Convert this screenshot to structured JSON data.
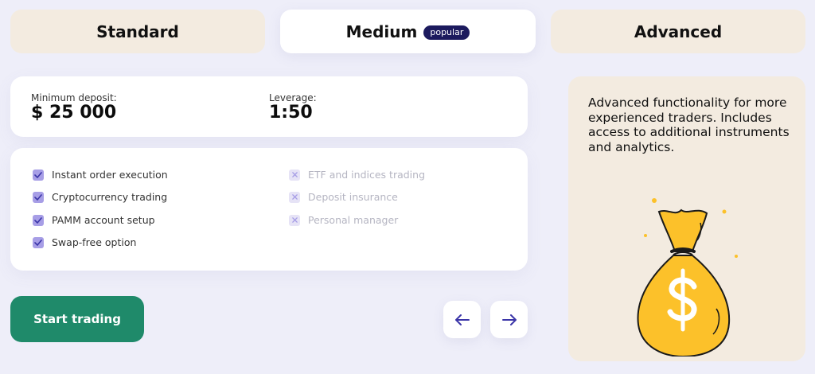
{
  "tabs": [
    {
      "label": "Standard",
      "active": false
    },
    {
      "label": "Medium",
      "active": true,
      "badge": "popular"
    },
    {
      "label": "Advanced",
      "active": false
    }
  ],
  "stats": {
    "deposit": {
      "label": "Minimum deposit:",
      "value": "$ 25 000"
    },
    "leverage": {
      "label": "Leverage:",
      "value": "1:50"
    }
  },
  "features": {
    "included": [
      "Instant order execution",
      "Cryptocurrency trading",
      "PAMM account setup",
      "Swap-free option"
    ],
    "excluded": [
      "ETF and indices trading",
      "Deposit insurance",
      "Personal manager"
    ]
  },
  "cta": {
    "label": "Start trading"
  },
  "nav": {
    "prev_icon": "arrow-left-icon",
    "next_icon": "arrow-right-icon"
  },
  "side_panel": {
    "text": "Advanced functionality for more experienced traders. Includes access to additional instruments and analytics.",
    "illustration": "money-bag-icon"
  },
  "colors": {
    "background": "#eeeef9",
    "tab_inactive": "#f3ebe0",
    "badge": "#1c1a5e",
    "accent_green": "#1f8a6a",
    "check_on": "#a79ee6",
    "check_off": "#e6e3f6",
    "nav_arrow": "#3b35a8",
    "bag_yellow": "#fcc12a"
  }
}
